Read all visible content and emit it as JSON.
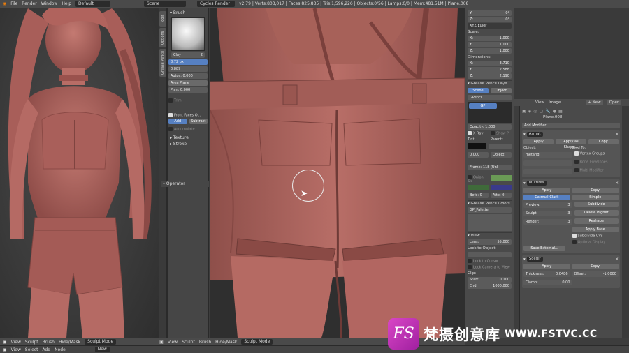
{
  "topbar": {
    "menus": [
      "File",
      "Render",
      "Window",
      "Help"
    ],
    "screen_layout": "Default",
    "scene": "Scene",
    "engine": "Cycles Render",
    "stats": "v2.79 | Verts:803,017 | Faces:825,835 | Tris:1,596,226 | Objects:0/56 | Lamps:0/0 | Mem:481.51M | Plane.008"
  },
  "toolshelf": {
    "tabs": [
      "Tools",
      "Options",
      "Grease Pencil"
    ],
    "brush_header": "Brush",
    "brush_name": "Clay",
    "brush_users": "2",
    "radius": "8.72 px",
    "strength": "0.889",
    "autosmooth": "Autos: 0.000",
    "area_plane": "Area Plane",
    "plane_offset": "Plan: 0.000",
    "trim": "Trim",
    "front_faces": "Front Faces O...",
    "add_label": "Add",
    "subtract_label": "Subtract",
    "accumulate": "Accumulate",
    "texture": "Texture",
    "stroke": "Stroke",
    "operator": "Operator"
  },
  "npanel": {
    "rot_y": "0°",
    "rot_z": "0°",
    "rot_mode": "XYZ Euler",
    "scale_label": "Scale:",
    "scale": [
      {
        "axis": "X:",
        "value": "1.000"
      },
      {
        "axis": "Y:",
        "value": "1.000"
      },
      {
        "axis": "Z:",
        "value": "1.000"
      }
    ],
    "dimensions_label": "Dimensions:",
    "dimensions": [
      {
        "axis": "X:",
        "value": "3.710"
      },
      {
        "axis": "Y:",
        "value": "2.588"
      },
      {
        "axis": "Z:",
        "value": "2.190"
      }
    ],
    "gp_layers": "Grease Pencil Laye",
    "gp_scene": "Scene",
    "gp_object": "Object",
    "gp_name": "GPenci",
    "gp_layer": "GP",
    "opacity": "Opacity: 1.000",
    "xray": "X Ray",
    "show_points": "Show P",
    "tint": "Tint",
    "parent": "Parent:",
    "tint_value": "0.000",
    "parent_value": "Object",
    "frame": "Frame: 118 (Unl",
    "onion": "Onion Sk",
    "before": "Befo: 0",
    "after": "Afte: 0",
    "gp_colors": "Grease Pencil Colors",
    "palette": "GP_Palette",
    "view": "View",
    "lens": "Lens:",
    "lens_value": "55.000",
    "lock_to_object": "Lock to Object:",
    "lock_cursor": "Lock to Cursor",
    "lock_camera": "Lock Camera to View",
    "clip": "Clip:",
    "clip_start": "Start:",
    "clip_start_value": "0.100",
    "clip_end": "End:",
    "clip_end_value": "1000.000"
  },
  "outliner": {
    "menus": [
      "View",
      "Image"
    ],
    "new_label": "New",
    "open_label": "Open"
  },
  "properties": {
    "object_name": "Plane.008",
    "add_modifier": "Add Modifier",
    "armature": {
      "name": "Armat",
      "apply": "Apply",
      "apply_shape": "Apply as Shape...",
      "copy": "Copy",
      "object_label": "Object:",
      "object_value": "metarig",
      "bind_to": "Bind To:",
      "vertex_groups": "Vertex Groups",
      "bone_envelopes": "Bone Envelopes",
      "multi_modifier": "Multi Modifier"
    },
    "multires": {
      "name": "Multires",
      "apply": "Apply",
      "copy": "Copy",
      "catmull": "Catmull-Clark",
      "simple": "Simple",
      "preview": "Preview:",
      "preview_value": "3",
      "sculpt": "Sculpt:",
      "sculpt_value": "3",
      "render": "Render:",
      "render_value": "3",
      "subdivide": "Subdivide",
      "delete_higher": "Delete Higher",
      "reshape": "Reshape",
      "apply_base": "Apply Base",
      "subdivide_uvs": "Subdivide UVs",
      "optimal_display": "Optimal Display",
      "save_external": "Save External..."
    },
    "solidify": {
      "name": "Solidif",
      "apply": "Apply",
      "copy": "Copy",
      "thickness": "Thickness:",
      "thickness_value": "0.0486",
      "offset": "Offset:",
      "offset_value": "-1.0000",
      "clamp": "Clamp:",
      "clamp_value": "0.00"
    }
  },
  "bottom_left": {
    "menus": [
      "View",
      "Sculpt",
      "Brush",
      "Hide/Mask"
    ],
    "mode": "Sculpt Mode"
  },
  "bottom_main": {
    "menus": [
      "View",
      "Sculpt",
      "Brush",
      "Hide/Mask"
    ],
    "mode": "Sculpt Mode"
  },
  "bottom_bar2": {
    "menus": [
      "View",
      "Select",
      "Add",
      "Node"
    ],
    "new_label": "New"
  },
  "watermark": {
    "logo": "FS",
    "text": "梵摄创意库",
    "url": "WWW.FSTVC.CC"
  },
  "colors": {
    "skin": "#b56a64",
    "accent": "#5680c2",
    "panel": "#4a4a4a"
  }
}
